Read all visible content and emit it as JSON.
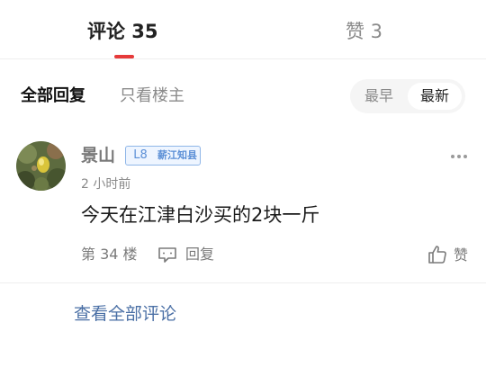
{
  "tabs": {
    "comments_label": "评论 35",
    "likes_label": "赞 3"
  },
  "filter": {
    "all_replies": "全部回复",
    "only_op": "只看楼主",
    "sort_earliest": "最早",
    "sort_latest": "最新",
    "selected_sort": "最新"
  },
  "comment": {
    "username": "景山",
    "level": "L8",
    "level_title": "薪江知县",
    "time": "2 小时前",
    "text": "今天在江津白沙买的2块一斤",
    "floor": "第 34 楼",
    "reply_label": "回复",
    "like_label": "赞",
    "more_icon": "more-dots-icon"
  },
  "footer": {
    "view_all": "查看全部评论"
  },
  "colors": {
    "accent_red": "#e63a3a",
    "link_blue": "#4a6fa5",
    "badge_blue": "#5b8fd6"
  }
}
